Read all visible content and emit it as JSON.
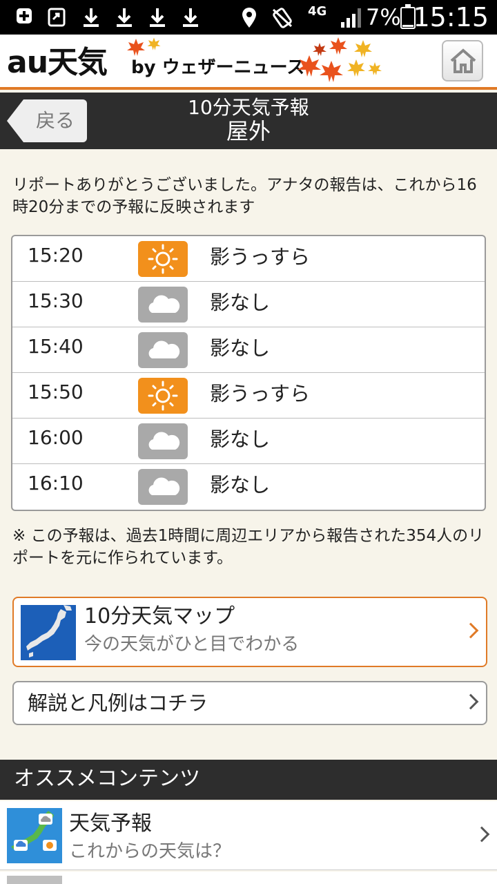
{
  "status_bar": {
    "time": "15:15",
    "battery": "7%",
    "network": "4G",
    "icons": [
      "add-box-icon",
      "screen-share-icon",
      "download-icon",
      "download-icon",
      "download-icon",
      "download-icon",
      "location-icon",
      "no-vibrate-icon",
      "signal-icon",
      "battery-icon"
    ]
  },
  "header": {
    "logo": "au天気",
    "byline": "by ウェザーニュース",
    "home_icon": "home-icon",
    "accent": "#e07a26"
  },
  "titlebar": {
    "back_label": "戻る",
    "title": "10分天気予報",
    "subtitle": "屋外"
  },
  "intro_text": "リポートありがとうございました。アナタの報告は、これから16時20分までの予報に反映されます",
  "forecast": [
    {
      "time": "15:20",
      "icon": "sun-icon",
      "text": "影うっすら"
    },
    {
      "time": "15:30",
      "icon": "cloud-icon",
      "text": "影なし"
    },
    {
      "time": "15:40",
      "icon": "cloud-icon",
      "text": "影なし"
    },
    {
      "time": "15:50",
      "icon": "sun-icon",
      "text": "影うっすら"
    },
    {
      "time": "16:00",
      "icon": "cloud-icon",
      "text": "影なし"
    },
    {
      "time": "16:10",
      "icon": "cloud-icon",
      "text": "影なし"
    }
  ],
  "note_text": "※ この予報は、過去1時間に周辺エリアから報告された354人のリポートを元に作られています。",
  "map_button": {
    "title": "10分天気マップ",
    "subtitle": "今の天気がひと目でわかる"
  },
  "legend_button": {
    "label": "解説と凡例はコチラ"
  },
  "recommend": {
    "title": "オススメコンテンツ",
    "items": [
      {
        "title": "天気予報",
        "subtitle": "これからの天気は？"
      }
    ]
  }
}
